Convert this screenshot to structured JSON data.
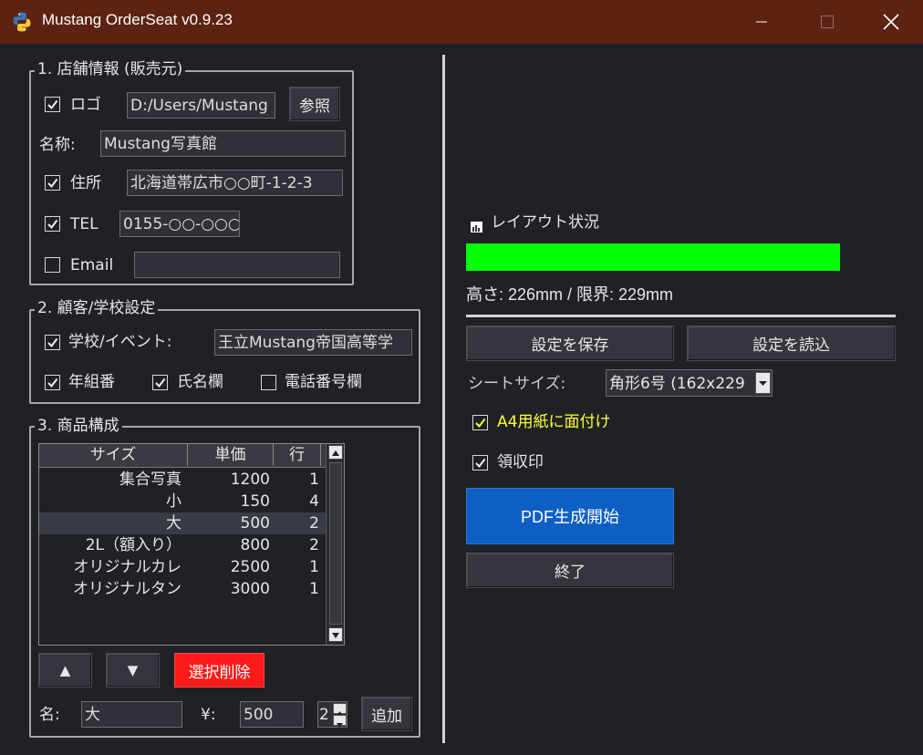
{
  "window": {
    "title": "Mustang OrderSeat v0.9.23"
  },
  "icons": {
    "app": "python-icon",
    "minimize": "minimize-icon",
    "maximize": "maximize-icon",
    "close": "close-icon"
  },
  "store": {
    "legend": "1. 店舗情報 (販売元)",
    "logo_label": "ロゴ",
    "logo_checked": true,
    "logo_path": "D:/Users/Mustang",
    "browse_label": "参照",
    "name_label": "名称:",
    "name_value": "Mustang写真館",
    "address_label": "住所",
    "address_checked": true,
    "address_value": "北海道帯広市○○町-1-2-3",
    "tel_label": "TEL",
    "tel_checked": true,
    "tel_value": "0155-○○-○○○○",
    "email_label": "Email",
    "email_checked": false,
    "email_value": ""
  },
  "customer": {
    "legend": "2. 顧客/学校設定",
    "school_label": "学校/イベント:",
    "school_checked": true,
    "school_value": "王立Mustang帝国高等学",
    "class_label": "年組番",
    "class_checked": true,
    "name_col_label": "氏名欄",
    "name_col_checked": true,
    "phone_col_label": "電話番号欄",
    "phone_col_checked": false
  },
  "products": {
    "legend": "3. 商品構成",
    "columns": [
      "サイズ",
      "単価",
      "行"
    ],
    "rows": [
      {
        "size": "集合写真",
        "price": "1200",
        "lines": "1",
        "selected": false
      },
      {
        "size": "小",
        "price": "150",
        "lines": "4",
        "selected": false
      },
      {
        "size": "大",
        "price": "500",
        "lines": "2",
        "selected": true
      },
      {
        "size": "2L（額入り）",
        "price": "800",
        "lines": "2",
        "selected": false
      },
      {
        "size": "オリジナルカレ",
        "price": "2500",
        "lines": "1",
        "selected": false
      },
      {
        "size": "オリジナルタン",
        "price": "3000",
        "lines": "1",
        "selected": false
      }
    ],
    "up_label": "▲",
    "down_label": "▼",
    "delete_label": "選択削除",
    "name_label": "名:",
    "name_value": "大",
    "price_label": "¥:",
    "price_value": "500",
    "lines_value": "2",
    "add_label": "追加"
  },
  "layout_status": {
    "title": "レイアウト状況",
    "progress_fraction": 0.987,
    "bar_color": "#00ff00",
    "status_text": "高さ: 226mm / 限界: 229mm"
  },
  "actions": {
    "save_label": "設定を保存",
    "load_label": "設定を読込",
    "sheet_size_label": "シートサイズ:",
    "sheet_size_value": "角形6号 (162x229",
    "a4_label": "A4用紙に面付け",
    "a4_checked": true,
    "receipt_label": "領収印",
    "receipt_checked": true,
    "pdf_label": "PDF生成開始",
    "exit_label": "終了"
  },
  "colors": {
    "titlebar": "#5c2313",
    "background": "#202125",
    "accent_button": "#0e5fc4",
    "delete_button": "#ff1a1a",
    "highlight_text": "#ffff33"
  }
}
